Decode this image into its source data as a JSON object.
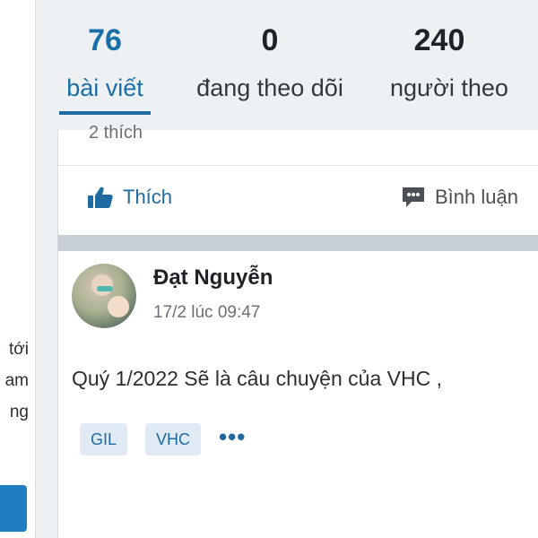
{
  "stats": [
    {
      "value": "76",
      "label": "bài viết",
      "active": true
    },
    {
      "value": "0",
      "label": "đang theo dõi",
      "active": false
    },
    {
      "value": "240",
      "label": "người theo",
      "active": false
    }
  ],
  "sidebar": {
    "lines": [
      "tới",
      "am",
      "ng"
    ]
  },
  "prev_post": {
    "likes_text": "2 thích",
    "like_label": "Thích",
    "comment_label": "Bình luận"
  },
  "post": {
    "author": "Đạt Nguyễn",
    "time": "17/2 lúc 09:47",
    "text": "Quý 1/2022 Sẽ là câu chuyện của VHC ,",
    "tags": [
      "GIL",
      "VHC"
    ],
    "more": "•••"
  },
  "colors": {
    "accent": "#1f6aa0",
    "background": "#eef1f4"
  }
}
